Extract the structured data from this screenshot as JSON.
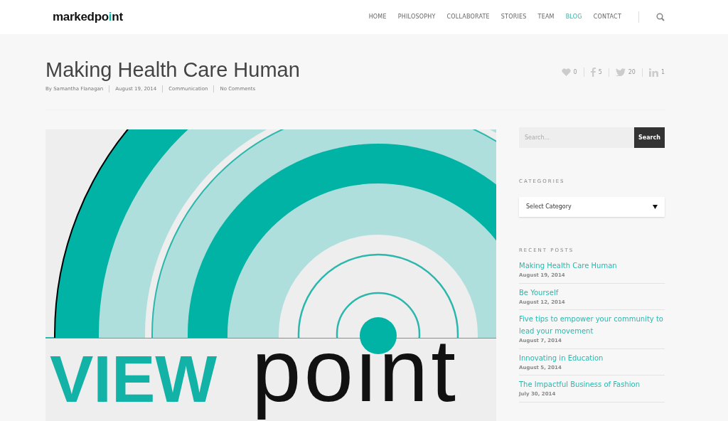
{
  "header": {
    "logo": "markedpoint",
    "nav": [
      {
        "label": "HOME",
        "selected": false
      },
      {
        "label": "PHILOSOPHY",
        "selected": false
      },
      {
        "label": "COLLABORATE",
        "selected": false
      },
      {
        "label": "STORIES",
        "selected": false
      },
      {
        "label": "TEAM",
        "selected": false
      },
      {
        "label": "BLOG",
        "selected": true
      },
      {
        "label": "CONTACT",
        "selected": false
      }
    ]
  },
  "post": {
    "title": "Making Health Care Human",
    "meta": [
      "By Samantha Flanagan",
      "August 19, 2014",
      "Communication",
      "No Comments"
    ],
    "shares": [
      {
        "kind": "heart",
        "count": "0"
      },
      {
        "kind": "facebook",
        "count": "5"
      },
      {
        "kind": "twitter",
        "count": "20"
      },
      {
        "kind": "linkedin",
        "count": "1"
      }
    ],
    "image": {
      "word_1": "VIEW",
      "word_2": "point"
    }
  },
  "sidebar": {
    "search": {
      "placeholder": "Search...",
      "button": "Search"
    },
    "categories": {
      "heading": "CATEGORIES",
      "select": "Select Category"
    },
    "recent_posts": {
      "heading": "RECENT POSTS",
      "items": [
        {
          "title": "Making Health Care Human",
          "date": "August 19, 2014"
        },
        {
          "title": "Be Yourself",
          "date": "August 12, 2014"
        },
        {
          "title": "Five tips to empower your community to lead your movement",
          "date": "August 7, 2014"
        },
        {
          "title": "Innovating in Education",
          "date": "August 5, 2014"
        },
        {
          "title": "The Impactful Business of Fashion",
          "date": "July 30, 2014"
        }
      ]
    }
  }
}
